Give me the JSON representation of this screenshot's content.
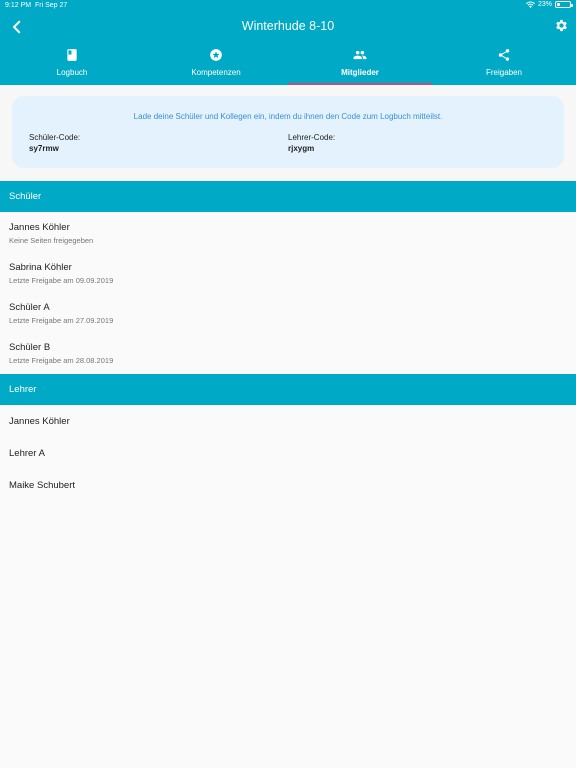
{
  "status": {
    "time": "9:12 PM",
    "date": "Fri Sep 27",
    "battery": "23%",
    "battery_level": 0.23
  },
  "header": {
    "title": "Winterhude 8-10"
  },
  "colors": {
    "primary": "#00a9c5",
    "tab_indicator": "#b5527e",
    "card_bg": "#e3f2fc",
    "invite_text": "#3b8fd6"
  },
  "tabs": [
    {
      "label": "Logbuch",
      "icon": "book-icon",
      "active": false
    },
    {
      "label": "Kompetenzen",
      "icon": "star-badge-icon",
      "active": false
    },
    {
      "label": "Mitglieder",
      "icon": "people-icon",
      "active": true
    },
    {
      "label": "Freigaben",
      "icon": "share-icon",
      "active": false
    }
  ],
  "invite": {
    "text": "Lade deine Schüler und Kollegen ein, indem du ihnen den Code zum Logbuch mitteilst.",
    "student_code_label": "Schüler-Code:",
    "student_code": "sy7rmw",
    "teacher_code_label": "Lehrer-Code:",
    "teacher_code": "rjxygm"
  },
  "students": {
    "heading": "Schüler",
    "items": [
      {
        "name": "Jannes Köhler",
        "sub": "Keine Seiten freigegeben"
      },
      {
        "name": "Sabrina Köhler",
        "sub": "Letzte Freigabe am 09.09.2019"
      },
      {
        "name": "Schüler A",
        "sub": "Letzte Freigabe am 27.09.2019"
      },
      {
        "name": "Schüler B",
        "sub": "Letzte Freigabe am 28.08.2019"
      }
    ]
  },
  "teachers": {
    "heading": "Lehrer",
    "items": [
      {
        "name": "Jannes Köhler"
      },
      {
        "name": "Lehrer A"
      },
      {
        "name": "Maike Schubert"
      }
    ]
  }
}
